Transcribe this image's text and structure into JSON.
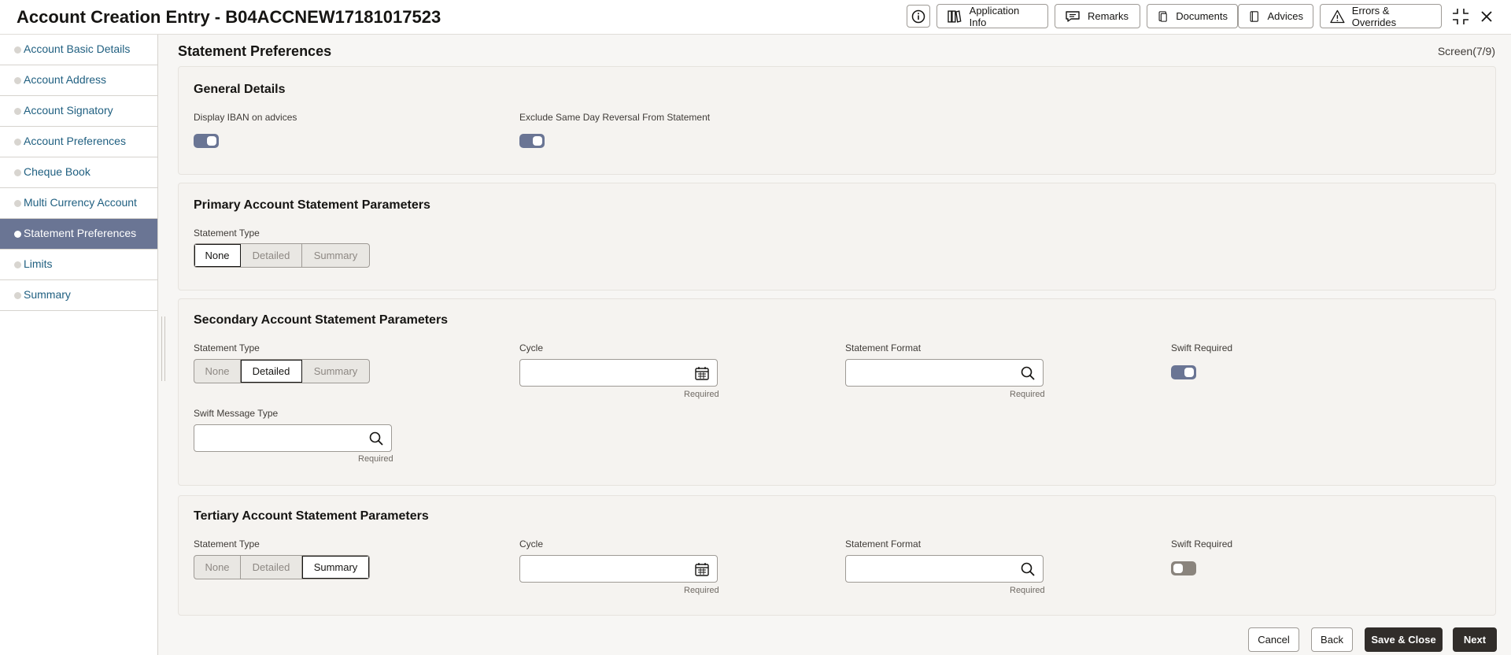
{
  "header": {
    "title": "Account Creation Entry - B04ACCNEW17181017523",
    "buttons": {
      "application_info": "Application Info",
      "remarks": "Remarks",
      "documents": "Documents",
      "advices": "Advices",
      "errors_overrides": "Errors & Overrides"
    },
    "icons": [
      "info-icon",
      "maximize-icon",
      "close-icon"
    ]
  },
  "sidebar": {
    "items": [
      {
        "label": "Account Basic Details"
      },
      {
        "label": "Account Address"
      },
      {
        "label": "Account Signatory"
      },
      {
        "label": "Account Preferences"
      },
      {
        "label": "Cheque Book"
      },
      {
        "label": "Multi Currency Account"
      },
      {
        "label": "Statement Preferences",
        "active": true
      },
      {
        "label": "Limits"
      },
      {
        "label": "Summary"
      }
    ]
  },
  "main": {
    "title": "Statement Preferences",
    "screen": "Screen(7/9)",
    "general": {
      "title": "General Details",
      "display_iban_label": "Display IBAN on advices",
      "display_iban_on": true,
      "exclude_reversal_label": "Exclude Same Day Reversal From Statement",
      "exclude_reversal_on": true
    },
    "primary": {
      "title": "Primary Account Statement Parameters",
      "statement_type_label": "Statement Type",
      "statement_type_options": [
        "None",
        "Detailed",
        "Summary"
      ],
      "statement_type_selected": "None"
    },
    "secondary": {
      "title": "Secondary Account Statement Parameters",
      "statement_type_label": "Statement Type",
      "statement_type_options": [
        "None",
        "Detailed",
        "Summary"
      ],
      "statement_type_selected": "Detailed",
      "cycle_label": "Cycle",
      "cycle_value": "",
      "cycle_required": "Required",
      "format_label": "Statement Format",
      "format_value": "",
      "format_required": "Required",
      "swift_required_label": "Swift Required",
      "swift_required_on": true,
      "swift_msg_label": "Swift Message Type",
      "swift_msg_value": "",
      "swift_msg_required": "Required"
    },
    "tertiary": {
      "title": "Tertiary Account Statement Parameters",
      "statement_type_label": "Statement Type",
      "statement_type_options": [
        "None",
        "Detailed",
        "Summary"
      ],
      "statement_type_selected": "Summary",
      "cycle_label": "Cycle",
      "cycle_value": "",
      "cycle_required": "Required",
      "format_label": "Statement Format",
      "format_value": "",
      "format_required": "Required",
      "swift_required_label": "Swift Required",
      "swift_required_on": false
    }
  },
  "footer": {
    "cancel": "Cancel",
    "back": "Back",
    "save_close": "Save & Close",
    "next": "Next"
  },
  "colors": {
    "accent": "#6a7594",
    "primary_button": "#312d2a",
    "link": "#1f5f80"
  }
}
